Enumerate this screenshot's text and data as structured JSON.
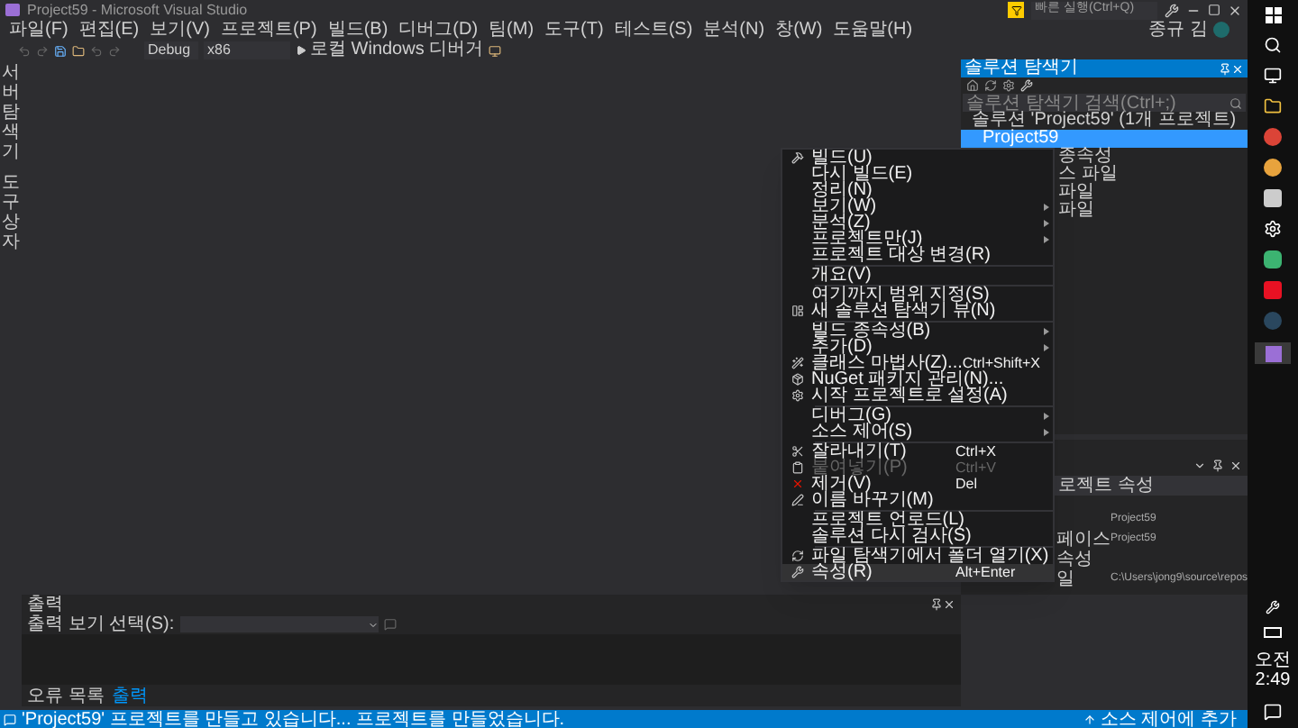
{
  "window": {
    "title": "Project59 - Microsoft Visual Studio"
  },
  "quick_launch": {
    "placeholder": "빠른 실행(Ctrl+Q)"
  },
  "menu_bar": [
    "파일(F)",
    "편집(E)",
    "보기(V)",
    "프로젝트(P)",
    "빌드(B)",
    "디버그(D)",
    "팀(M)",
    "도구(T)",
    "테스트(S)",
    "분석(N)",
    "창(W)",
    "도움말(H)"
  ],
  "account": {
    "name": "종규 김"
  },
  "toolbar": {
    "configuration": "Debug",
    "platform": "x86",
    "debugger": "로컬 Windows 디버거"
  },
  "side_tabs": [
    "서버 탐색기",
    "도구 상자"
  ],
  "solution_explorer": {
    "title": "솔루션 탐색기",
    "search": {
      "placeholder": "솔루션 탐색기 검색(Ctrl+;)"
    },
    "tree": [
      {
        "label": "솔루션 'Project59' (1개 프로젝트)",
        "selected": false,
        "children": [
          {
            "label": "Project59",
            "selected": true,
            "children": [
              {
                "label": "종속성",
                "selected": false
              },
              {
                "label": "스 파일",
                "selected": false
              },
              {
                "label": "파일",
                "selected": false
              },
              {
                "label": "파일",
                "selected": false
              }
            ]
          }
        ]
      }
    ]
  },
  "properties": {
    "dropdown": "로젝트 속성",
    "rows": [
      {
        "value": "Project59"
      },
      {
        "name": "페이스",
        "value": "Project59"
      },
      {
        "name": "속성"
      },
      {
        "name": "일",
        "value": "C:\\Users\\jong9\\source\\repos"
      }
    ]
  },
  "context_menu": [
    {
      "kind": "item",
      "label": "빌드(U)",
      "selected": false
    },
    {
      "kind": "item",
      "label": "다시 빌드(E)",
      "selected": false
    },
    {
      "kind": "item",
      "label": "정리(N)",
      "selected": false
    },
    {
      "kind": "item",
      "label": "보기(W)",
      "submenu": true,
      "selected": false
    },
    {
      "kind": "item",
      "label": "분석(Z)",
      "submenu": true,
      "selected": false
    },
    {
      "kind": "item",
      "label": "프로젝트만(J)",
      "submenu": true,
      "selected": false
    },
    {
      "kind": "item",
      "label": "프로젝트 대상 변경(R)",
      "selected": false
    },
    {
      "kind": "separator"
    },
    {
      "kind": "item",
      "label": "개요(V)",
      "selected": false
    },
    {
      "kind": "separator"
    },
    {
      "kind": "item",
      "label": "여기까지 범위 지정(S)",
      "selected": false
    },
    {
      "kind": "item",
      "label": "새 솔루션 탐색기 뷰(N)",
      "selected": false
    },
    {
      "kind": "separator"
    },
    {
      "kind": "item",
      "label": "빌드 종속성(B)",
      "submenu": true,
      "selected": false
    },
    {
      "kind": "item",
      "label": "추가(D)",
      "submenu": true,
      "selected": false
    },
    {
      "kind": "item",
      "label": "클래스 마법사(Z)...",
      "shortcut": "Ctrl+Shift+X",
      "selected": false
    },
    {
      "kind": "item",
      "label": "NuGet 패키지 관리(N)...",
      "selected": false
    },
    {
      "kind": "item",
      "label": "시작 프로젝트로 설정(A)",
      "selected": false
    },
    {
      "kind": "separator"
    },
    {
      "kind": "item",
      "label": "디버그(G)",
      "submenu": true,
      "selected": false
    },
    {
      "kind": "item",
      "label": "소스 제어(S)",
      "submenu": true,
      "selected": false
    },
    {
      "kind": "separator"
    },
    {
      "kind": "item",
      "label": "잘라내기(T)",
      "shortcut": "Ctrl+X",
      "selected": false
    },
    {
      "kind": "item",
      "label": "붙여넣기(P)",
      "shortcut": "Ctrl+V",
      "disabled": true,
      "selected": false
    },
    {
      "kind": "item",
      "label": "제거(V)",
      "shortcut": "Del",
      "selected": false
    },
    {
      "kind": "item",
      "label": "이름 바꾸기(M)",
      "selected": false
    },
    {
      "kind": "separator"
    },
    {
      "kind": "item",
      "label": "프로젝트 언로드(L)",
      "selected": false
    },
    {
      "kind": "item",
      "label": "솔루션 다시 검사(S)",
      "selected": false
    },
    {
      "kind": "separator"
    },
    {
      "kind": "item",
      "label": "파일 탐색기에서 폴더 열기(X)",
      "selected": false
    },
    {
      "kind": "item",
      "label": "속성(R)",
      "shortcut": "Alt+Enter",
      "selected": true
    }
  ],
  "output": {
    "title": "출력",
    "source_label": "출력 보기 선택(S):"
  },
  "bottom_tabs": [
    {
      "label": "오류 목록",
      "selected": false
    },
    {
      "label": "출력",
      "selected": true
    }
  ],
  "status_bar": {
    "message": "'Project59' 프로젝트를 만들고 있습니다... 프로젝트를 만들었습니다.",
    "action": "소스 제어에 추가"
  },
  "taskbar": {
    "clock": "오전 2:49"
  }
}
